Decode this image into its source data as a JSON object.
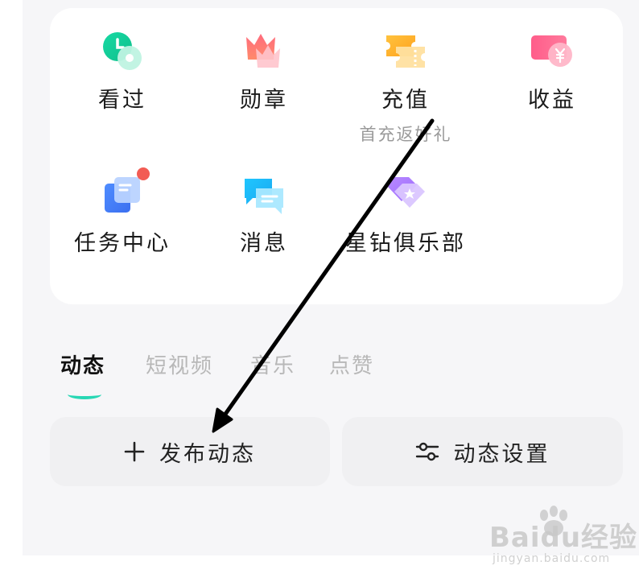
{
  "grid": {
    "history": {
      "label": "看过",
      "icon": "clock-disc-icon"
    },
    "medals": {
      "label": "勋章",
      "icon": "crown-icon"
    },
    "recharge": {
      "label": "充值",
      "sublabel": "首充返好礼",
      "icon": "ticket-icon"
    },
    "earnings": {
      "label": "收益",
      "icon": "wallet-yuan-icon"
    },
    "task_center": {
      "label": "任务中心",
      "icon": "task-card-icon",
      "has_badge": true
    },
    "messages": {
      "label": "消息",
      "icon": "chat-bubble-icon"
    },
    "star_club": {
      "label": "星钻俱乐部",
      "icon": "diamond-star-icon"
    }
  },
  "tabs": [
    {
      "label": "动态",
      "active": true
    },
    {
      "label": "短视频",
      "active": false
    },
    {
      "label": "音乐",
      "active": false
    },
    {
      "label": "点赞",
      "active": false
    }
  ],
  "actions": {
    "post_label": "发布动态",
    "settings_label": "动态设置"
  },
  "watermark": {
    "brand": "Baidu经验",
    "url": "jingyan.baidu.com"
  },
  "colors": {
    "accent": "#28d7b4",
    "badge": "#f25c54",
    "annotation_arrow": "#000000"
  }
}
